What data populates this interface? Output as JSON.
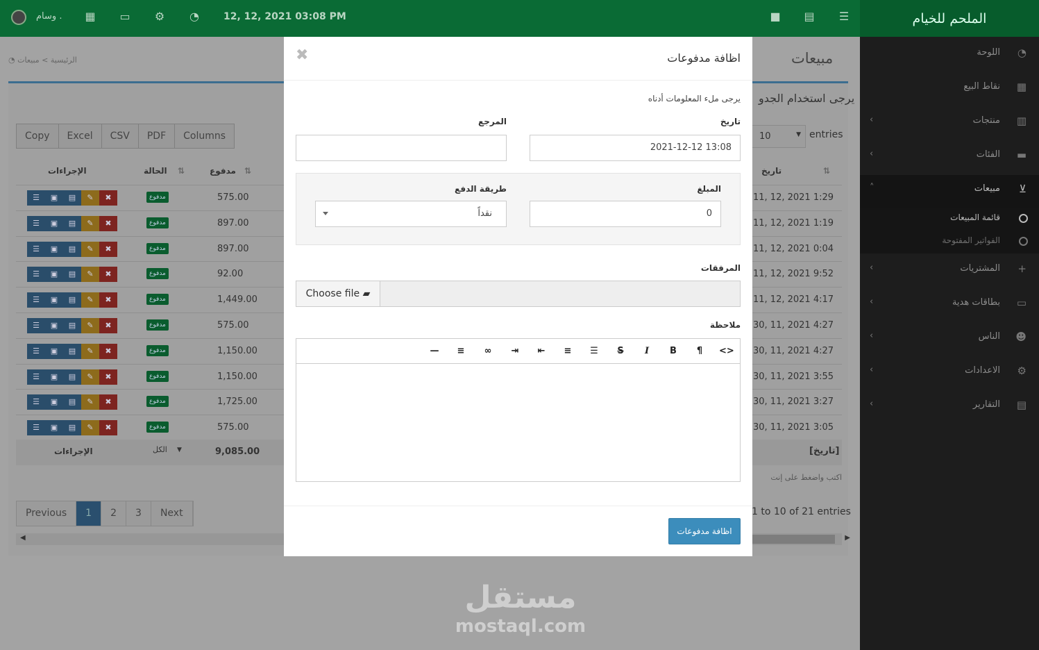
{
  "app": {
    "brand": "الملحم للخيام",
    "username": "وسام .",
    "datetime": "12, 12, 2021 03:08 PM"
  },
  "sidebar": {
    "items": [
      {
        "label": "اللوحة",
        "icon": "dashboard-icon"
      },
      {
        "label": "نقاط البيع",
        "icon": "pos-grid-icon"
      },
      {
        "label": "منتجات",
        "icon": "barcode-icon"
      },
      {
        "label": "الفئات",
        "icon": "folder-icon"
      },
      {
        "label": "مبيعات",
        "icon": "cart-icon"
      },
      {
        "label": "المشتريات",
        "icon": "plus-icon"
      },
      {
        "label": "بطاقات هدية",
        "icon": "credit-card-icon"
      },
      {
        "label": "الناس",
        "icon": "users-icon"
      },
      {
        "label": "الاعدادات",
        "icon": "cogs-icon"
      },
      {
        "label": "التقارير",
        "icon": "bar-chart-icon"
      }
    ],
    "subitems": [
      {
        "label": "قائمة المبيعات"
      },
      {
        "label": "الفواتير المفتوحة"
      }
    ]
  },
  "page": {
    "title": "مبيعات",
    "breadcrumb": [
      "الرئيسية",
      "مبيعات"
    ],
    "notice": "يرجى استخدام الجدو",
    "entries_label": "entries",
    "entries_value": "10",
    "export_buttons": [
      "Copy",
      "Excel",
      "CSV",
      "PDF",
      "Columns"
    ],
    "columns": {
      "actions": "الإجراءات",
      "status": "الحالة",
      "paid": "مدفوع",
      "date": "تاريخ"
    },
    "rows": [
      {
        "paid": "575.00",
        "status": "مدفوع",
        "date": "11, 12, 2021 1:29"
      },
      {
        "paid": "897.00",
        "status": "مدفوع",
        "date": "11, 12, 2021 1:19"
      },
      {
        "paid": "897.00",
        "status": "مدفوع",
        "date": "11, 12, 2021 0:04"
      },
      {
        "paid": "92.00",
        "status": "مدفوع",
        "date": "11, 12, 2021 9:52"
      },
      {
        "paid": "1,449.00",
        "status": "مدفوع",
        "date": "11, 12, 2021 4:17"
      },
      {
        "paid": "575.00",
        "status": "مدفوع",
        "date": "30, 11, 2021 4:27"
      },
      {
        "paid": "1,150.00",
        "status": "مدفوع",
        "date": "30, 11, 2021 4:27"
      },
      {
        "paid": "1,150.00",
        "status": "مدفوع",
        "date": "30, 11, 2021 3:55"
      },
      {
        "paid": "1,725.00",
        "status": "مدفوع",
        "date": "30, 11, 2021 3:27"
      },
      {
        "paid": "575.00",
        "status": "مدفوع",
        "date": "30, 11, 2021 3:05"
      }
    ],
    "footer": {
      "total": "9,085.00",
      "status_filter": "الكل",
      "actions": "الإجراءات",
      "date_filter": "[تاريخ]",
      "search_hint": "اكتب واضغط على إنت"
    },
    "pagination": {
      "prev": "Previous",
      "pages": [
        "1",
        "2",
        "3"
      ],
      "next": "Next"
    },
    "info": "1 to 10 of 21 entries"
  },
  "modal": {
    "title": "اظافة مدفوعات",
    "intro": "يرجى ملء المعلومات أدناه",
    "date_label": "تاريخ",
    "date_value": "2021-12-12 13:08",
    "reference_label": "المرجع",
    "reference_value": "",
    "amount_label": "المبلغ",
    "amount_value": "0",
    "method_label": "طريقة الدفع",
    "method_value": "نقداً",
    "attachments_label": "المرفقات",
    "choose_file": "Choose file",
    "note_label": "ملاحظة",
    "submit": "اظافة مدفوعات"
  },
  "watermark": {
    "arabic": "مستقل",
    "english": "mostaql.com"
  }
}
